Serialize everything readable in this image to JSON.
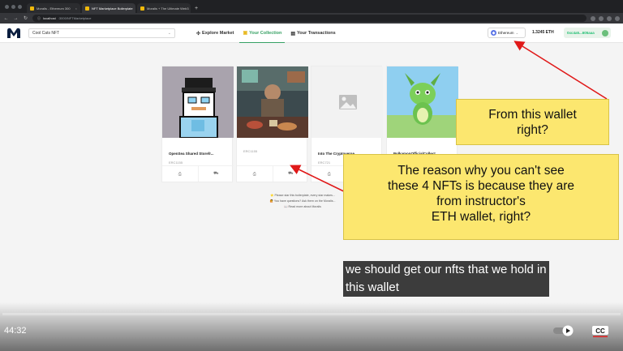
{
  "browser": {
    "tabs": [
      {
        "title": "Moralis - Ethereum 300",
        "active": false
      },
      {
        "title": "NFT Marketplace Boilerplate",
        "active": true
      },
      {
        "title": "Moralis + The Ultimate Web3",
        "active": false
      }
    ],
    "new_tab_symbol": "+",
    "url_host": "localhost",
    "url_path": ":3000/NFTMarketplace"
  },
  "app": {
    "search_value": "Cool Cats NFT",
    "menu": [
      {
        "label": "Explore Market",
        "icon": "compass-icon",
        "active": false
      },
      {
        "label": "Your Collection",
        "icon": "collection-icon",
        "active": true
      },
      {
        "label": "Your Transactions",
        "icon": "document-icon",
        "active": false
      }
    ],
    "chain_label": "Ethereum",
    "balance": "1.3245 ETH",
    "account": "0xc4a5...605aaa",
    "colors": {
      "accent": "#37a164",
      "ethereum": "#5a74e6"
    }
  },
  "cards": [
    {
      "name": "OpenSea Shared Storefr...",
      "standard": "ERC1155",
      "art": "pixel-art-avatar"
    },
    {
      "name": "",
      "standard": "ERC1155",
      "art": "warrior-dining-scene"
    },
    {
      "name": "Into The Cryptoverse",
      "standard": "ERC721",
      "art": "image-placeholder-icon"
    },
    {
      "name": "PolkamonOfficialCollect...",
      "standard": "ERC1155",
      "art": "green-monster-creature"
    }
  ],
  "notes": [
    "⭐ Please star this boilerplate, every star makes...",
    "🙋 You have questions? Ask them on the Moralis...",
    "📖 Read more about Moralis"
  ],
  "annotations": {
    "callout_1": [
      "From this wallet",
      "right?"
    ],
    "callout_2": [
      "The reason why you can't see",
      "these 4 NFTs is because they are",
      "from instructor's",
      "ETH wallet, right?"
    ],
    "arrow_color": "#e01919"
  },
  "subtitle": [
    "we should get our nfts that we hold in",
    "this wallet"
  ],
  "player": {
    "time": "44:32",
    "cc_label": "CC"
  }
}
